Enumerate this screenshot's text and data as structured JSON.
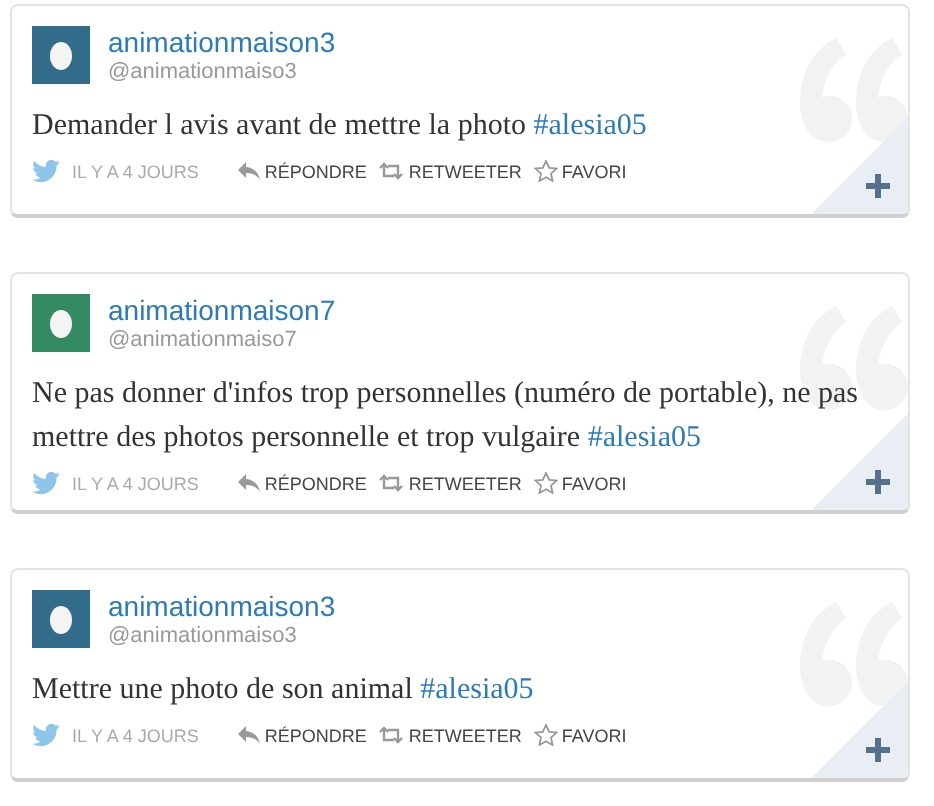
{
  "tweets": [
    {
      "name": "animationmaison3",
      "handle": "@animationmaiso3",
      "color": "#336b8a",
      "text": "Demander l avis avant de mettre la photo",
      "hashtag": "#alesia05",
      "time": "IL Y A 4 JOURS",
      "actions": [
        "RÉPONDRE",
        "RETWEETER",
        "FAVORI"
      ]
    },
    {
      "name": "animationmaison7",
      "handle": "@animationmaiso7",
      "color": "#338a63",
      "text": "Ne pas donner d'infos trop personnelles (numéro de portable), ne pas mettre des photos personnelle et trop vulgaire",
      "hashtag": "#alesia05",
      "time": "IL Y A 4 JOURS",
      "actions": [
        "RÉPONDRE",
        "RETWEETER",
        "FAVORI"
      ]
    },
    {
      "name": "animationmaison3",
      "handle": "@animationmaiso3",
      "color": "#336b8a",
      "text": "Mettre une photo de son animal",
      "hashtag": "#alesia05",
      "time": "IL Y A 4 JOURS",
      "actions": [
        "RÉPONDRE",
        "RETWEETER",
        "FAVORI"
      ]
    }
  ]
}
